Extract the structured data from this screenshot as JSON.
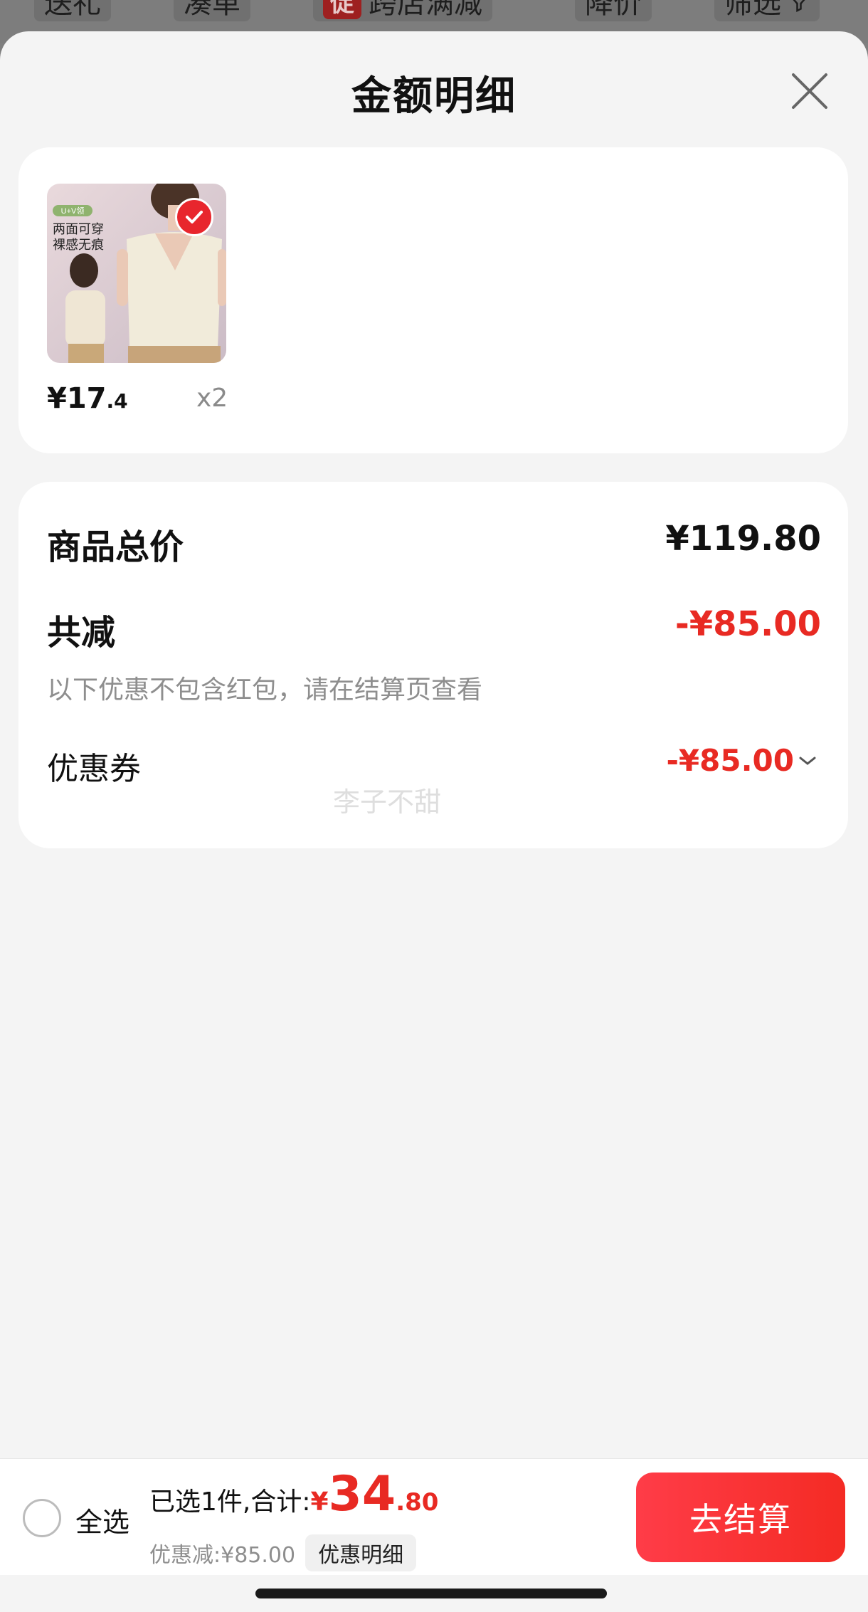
{
  "filter_bar": {
    "items": [
      "送礼",
      "凑单",
      "跨店满减",
      "降价",
      "筛选"
    ],
    "badge": "促"
  },
  "sheet": {
    "title": "金额明细"
  },
  "product": {
    "thumb_text_tag": "U+V领",
    "thumb_text_line1": "两面可穿",
    "thumb_text_line2": "裸感无痕",
    "price_symbol": "¥",
    "price_int": "17",
    "price_dec": ".4",
    "qty": "x2"
  },
  "summary": {
    "total_label": "商品总价",
    "total_value": "¥119.80",
    "reduce_label": "共减",
    "reduce_value": "-¥85.00",
    "note": "以下优惠不包含红包，请在结算页查看",
    "coupon_label": "优惠券",
    "coupon_value": "-¥85.00"
  },
  "watermark": "李子不甜",
  "bottom_bar": {
    "select_all": "全选",
    "selected_label": "已选1件,合计:",
    "total_symbol": "¥",
    "total_int": "34",
    "total_dec": ".80",
    "discount_text": "优惠减:¥85.00",
    "detail_chip": "优惠明细",
    "checkout": "去结算"
  },
  "colors": {
    "accent_red": "#e82a23",
    "checkout_gradient_start": "#ff3c48",
    "checkout_gradient_end": "#f42b24"
  }
}
